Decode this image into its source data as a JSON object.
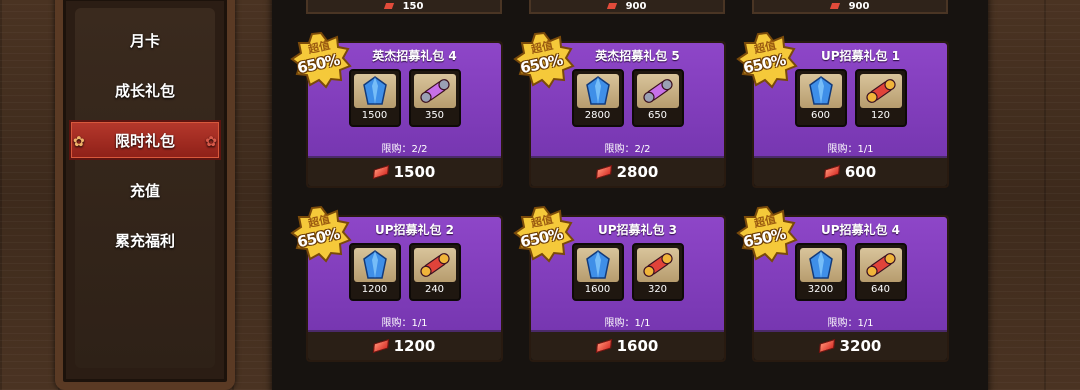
{
  "sidebar": {
    "items": [
      {
        "label": "月卡",
        "active": false
      },
      {
        "label": "成长礼包",
        "active": false
      },
      {
        "label": "限时礼包",
        "active": true
      },
      {
        "label": "充值",
        "active": false
      },
      {
        "label": "累充福利",
        "active": false
      }
    ]
  },
  "top_strips": [
    {
      "price": "150"
    },
    {
      "price": "900"
    },
    {
      "price": "900"
    }
  ],
  "cards": [
    {
      "title": "英杰招募礼包 4",
      "badge_top": "超值",
      "badge_bottom": "650%",
      "item1_count": "1500",
      "item2_count": "350",
      "item2_type": "scroll-purple",
      "limit": "限购：2/2",
      "price": "1500"
    },
    {
      "title": "英杰招募礼包 5",
      "badge_top": "超值",
      "badge_bottom": "650%",
      "item1_count": "2800",
      "item2_count": "650",
      "item2_type": "scroll-purple",
      "limit": "限购：2/2",
      "price": "2800"
    },
    {
      "title": "UP招募礼包 1",
      "badge_top": "超值",
      "badge_bottom": "650%",
      "item1_count": "600",
      "item2_count": "120",
      "item2_type": "scroll-red",
      "limit": "限购：1/1",
      "price": "600"
    },
    {
      "title": "UP招募礼包 2",
      "badge_top": "超值",
      "badge_bottom": "650%",
      "item1_count": "1200",
      "item2_count": "240",
      "item2_type": "scroll-red",
      "limit": "限购：1/1",
      "price": "1200"
    },
    {
      "title": "UP招募礼包 3",
      "badge_top": "超值",
      "badge_bottom": "650%",
      "item1_count": "1600",
      "item2_count": "320",
      "item2_type": "scroll-red",
      "limit": "限购：1/1",
      "price": "1600"
    },
    {
      "title": "UP招募礼包 4",
      "badge_top": "超值",
      "badge_bottom": "650%",
      "item1_count": "3200",
      "item2_count": "640",
      "item2_type": "scroll-red",
      "limit": "限购：1/1",
      "price": "3200"
    }
  ],
  "colors": {
    "card_purple": "#8e46c8",
    "active_tab": "#b6382c",
    "badge_gold": "#f5c93a",
    "currency_red": "#d8322a"
  }
}
